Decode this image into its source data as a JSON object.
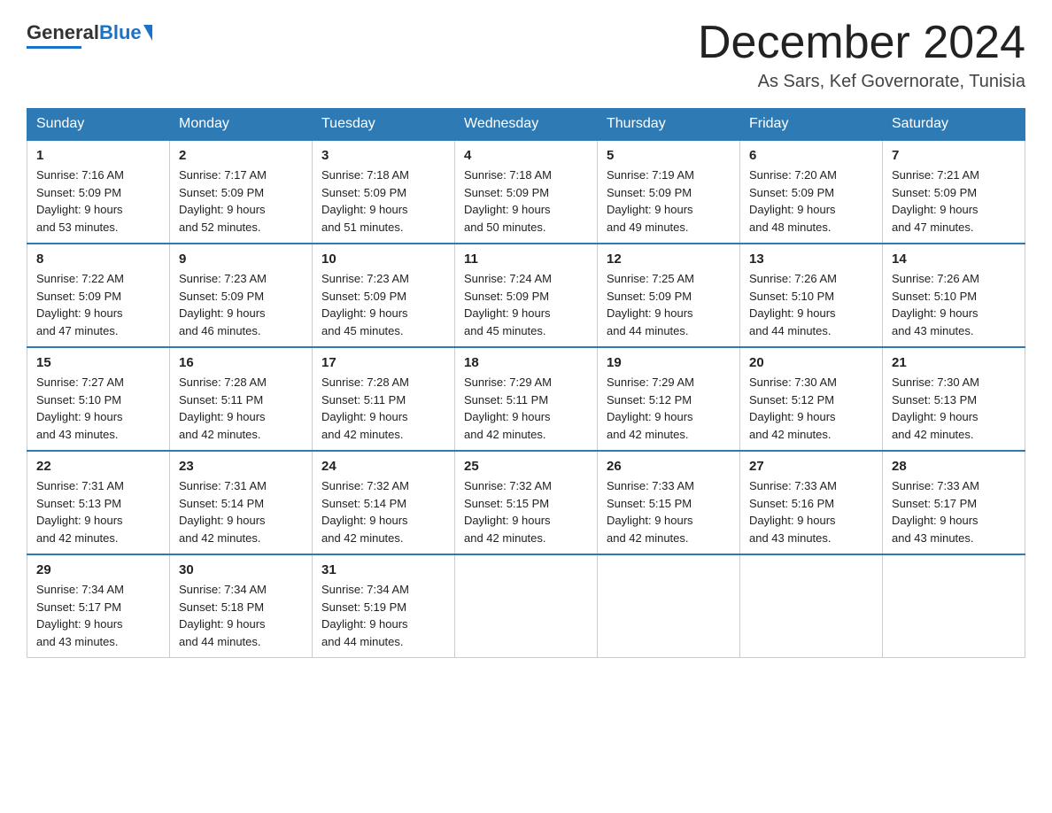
{
  "logo": {
    "general": "General",
    "blue": "Blue"
  },
  "title": "December 2024",
  "subtitle": "As Sars, Kef Governorate, Tunisia",
  "days_header": [
    "Sunday",
    "Monday",
    "Tuesday",
    "Wednesday",
    "Thursday",
    "Friday",
    "Saturday"
  ],
  "weeks": [
    [
      {
        "day": "1",
        "sunrise": "7:16 AM",
        "sunset": "5:09 PM",
        "daylight": "9 hours and 53 minutes."
      },
      {
        "day": "2",
        "sunrise": "7:17 AM",
        "sunset": "5:09 PM",
        "daylight": "9 hours and 52 minutes."
      },
      {
        "day": "3",
        "sunrise": "7:18 AM",
        "sunset": "5:09 PM",
        "daylight": "9 hours and 51 minutes."
      },
      {
        "day": "4",
        "sunrise": "7:18 AM",
        "sunset": "5:09 PM",
        "daylight": "9 hours and 50 minutes."
      },
      {
        "day": "5",
        "sunrise": "7:19 AM",
        "sunset": "5:09 PM",
        "daylight": "9 hours and 49 minutes."
      },
      {
        "day": "6",
        "sunrise": "7:20 AM",
        "sunset": "5:09 PM",
        "daylight": "9 hours and 48 minutes."
      },
      {
        "day": "7",
        "sunrise": "7:21 AM",
        "sunset": "5:09 PM",
        "daylight": "9 hours and 47 minutes."
      }
    ],
    [
      {
        "day": "8",
        "sunrise": "7:22 AM",
        "sunset": "5:09 PM",
        "daylight": "9 hours and 47 minutes."
      },
      {
        "day": "9",
        "sunrise": "7:23 AM",
        "sunset": "5:09 PM",
        "daylight": "9 hours and 46 minutes."
      },
      {
        "day": "10",
        "sunrise": "7:23 AM",
        "sunset": "5:09 PM",
        "daylight": "9 hours and 45 minutes."
      },
      {
        "day": "11",
        "sunrise": "7:24 AM",
        "sunset": "5:09 PM",
        "daylight": "9 hours and 45 minutes."
      },
      {
        "day": "12",
        "sunrise": "7:25 AM",
        "sunset": "5:09 PM",
        "daylight": "9 hours and 44 minutes."
      },
      {
        "day": "13",
        "sunrise": "7:26 AM",
        "sunset": "5:10 PM",
        "daylight": "9 hours and 44 minutes."
      },
      {
        "day": "14",
        "sunrise": "7:26 AM",
        "sunset": "5:10 PM",
        "daylight": "9 hours and 43 minutes."
      }
    ],
    [
      {
        "day": "15",
        "sunrise": "7:27 AM",
        "sunset": "5:10 PM",
        "daylight": "9 hours and 43 minutes."
      },
      {
        "day": "16",
        "sunrise": "7:28 AM",
        "sunset": "5:11 PM",
        "daylight": "9 hours and 42 minutes."
      },
      {
        "day": "17",
        "sunrise": "7:28 AM",
        "sunset": "5:11 PM",
        "daylight": "9 hours and 42 minutes."
      },
      {
        "day": "18",
        "sunrise": "7:29 AM",
        "sunset": "5:11 PM",
        "daylight": "9 hours and 42 minutes."
      },
      {
        "day": "19",
        "sunrise": "7:29 AM",
        "sunset": "5:12 PM",
        "daylight": "9 hours and 42 minutes."
      },
      {
        "day": "20",
        "sunrise": "7:30 AM",
        "sunset": "5:12 PM",
        "daylight": "9 hours and 42 minutes."
      },
      {
        "day": "21",
        "sunrise": "7:30 AM",
        "sunset": "5:13 PM",
        "daylight": "9 hours and 42 minutes."
      }
    ],
    [
      {
        "day": "22",
        "sunrise": "7:31 AM",
        "sunset": "5:13 PM",
        "daylight": "9 hours and 42 minutes."
      },
      {
        "day": "23",
        "sunrise": "7:31 AM",
        "sunset": "5:14 PM",
        "daylight": "9 hours and 42 minutes."
      },
      {
        "day": "24",
        "sunrise": "7:32 AM",
        "sunset": "5:14 PM",
        "daylight": "9 hours and 42 minutes."
      },
      {
        "day": "25",
        "sunrise": "7:32 AM",
        "sunset": "5:15 PM",
        "daylight": "9 hours and 42 minutes."
      },
      {
        "day": "26",
        "sunrise": "7:33 AM",
        "sunset": "5:15 PM",
        "daylight": "9 hours and 42 minutes."
      },
      {
        "day": "27",
        "sunrise": "7:33 AM",
        "sunset": "5:16 PM",
        "daylight": "9 hours and 43 minutes."
      },
      {
        "day": "28",
        "sunrise": "7:33 AM",
        "sunset": "5:17 PM",
        "daylight": "9 hours and 43 minutes."
      }
    ],
    [
      {
        "day": "29",
        "sunrise": "7:34 AM",
        "sunset": "5:17 PM",
        "daylight": "9 hours and 43 minutes."
      },
      {
        "day": "30",
        "sunrise": "7:34 AM",
        "sunset": "5:18 PM",
        "daylight": "9 hours and 44 minutes."
      },
      {
        "day": "31",
        "sunrise": "7:34 AM",
        "sunset": "5:19 PM",
        "daylight": "9 hours and 44 minutes."
      },
      null,
      null,
      null,
      null
    ]
  ],
  "labels": {
    "sunrise": "Sunrise:",
    "sunset": "Sunset:",
    "daylight": "Daylight:"
  }
}
